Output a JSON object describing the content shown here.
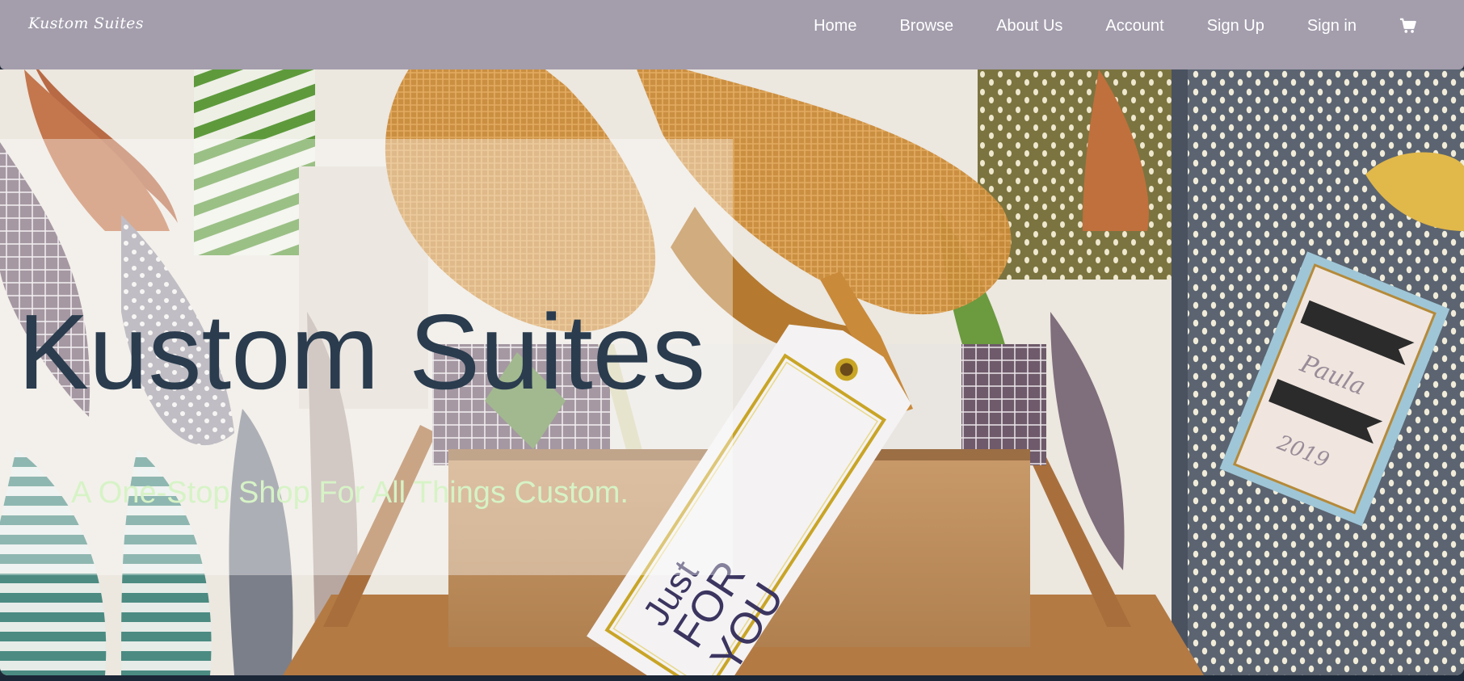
{
  "brand": {
    "name": "Kustom Suites"
  },
  "nav": {
    "items": [
      {
        "label": "Home"
      },
      {
        "label": "Browse"
      },
      {
        "label": "About Us"
      },
      {
        "label": "Account"
      },
      {
        "label": "Sign Up"
      },
      {
        "label": "Sign in"
      }
    ],
    "cart_icon": "shopping-cart-icon"
  },
  "hero": {
    "title": "Kustom Suites",
    "subtitle": "A One-Stop Shop For All Things Custom.",
    "tag_text_line1": "Just",
    "tag_text_line2": "FOR",
    "tag_text_line3": "YOU"
  },
  "colors": {
    "navbar": "#a39dac",
    "title": "#2a3c4e",
    "subtitle": "#d6f3c6"
  }
}
